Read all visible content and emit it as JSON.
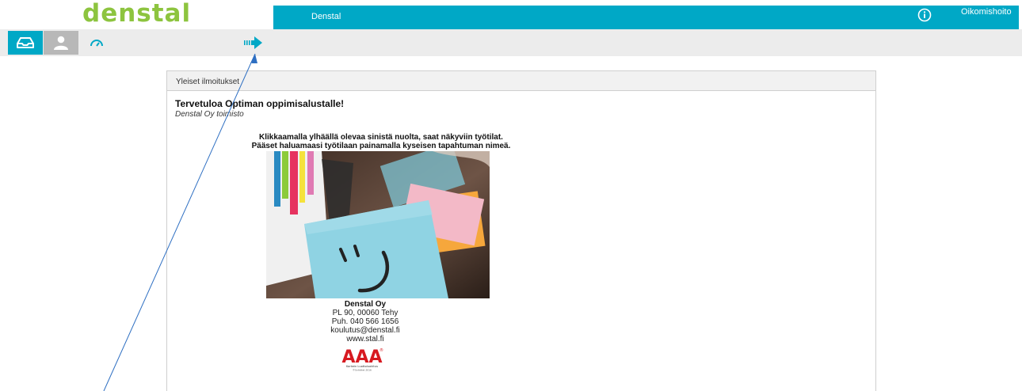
{
  "brand": {
    "logo_text": "denstal",
    "logo_color": "#8dc43f",
    "accent": "#00a8c6"
  },
  "topbar": {
    "title": "Denstal",
    "info_icon": "info-circle-icon",
    "user_label": "Oikomishoito"
  },
  "toolbar": {
    "buttons": [
      {
        "name": "inbox-icon"
      },
      {
        "name": "user-icon"
      },
      {
        "name": "gauge-icon"
      },
      {
        "name": "arrow-right-icon"
      }
    ]
  },
  "panel": {
    "header": "Yleiset ilmoitukset",
    "post_title": "Tervetuloa Optiman oppimisalustalle!",
    "post_author": "Denstal Oy toimisto",
    "instructions": [
      "Klikkaamalla ylhäällä olevaa sinistä nuolta, saat näkyviin työtilat.",
      "Pääset haluamaasi työtilaan painamalla kyseisen tapahtuman nimeä."
    ],
    "image_label": "sticky-notes-smiley-photo",
    "contact": {
      "company": "Denstal Oy",
      "address": "PL 90, 00060 Tehy",
      "phone": "Puh. 040 566 1656",
      "email": "koulutus@denstal.fi",
      "web": "www.stal.fi"
    },
    "badge": {
      "big": "AAA",
      "line1": "Korkein Luottoluokitus",
      "line2": "©Soliditet 2016"
    }
  }
}
